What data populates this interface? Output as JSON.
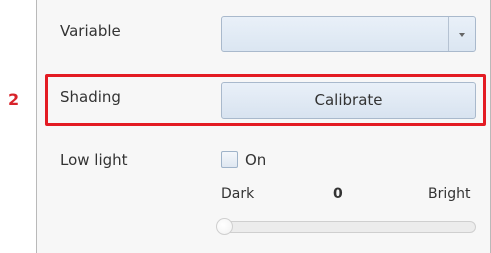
{
  "rows": {
    "variable": {
      "label": "Variable",
      "selected_value": ""
    },
    "shading": {
      "label": "Shading",
      "button_label": "Calibrate"
    },
    "low_light": {
      "label": "Low light",
      "checkbox_label": "On",
      "checked": false,
      "slider": {
        "min_label": "Dark",
        "max_label": "Bright",
        "value_display": "0",
        "value_fraction": 0
      }
    }
  },
  "annotation": {
    "step_number": "2",
    "color": "#e31b23"
  },
  "icons": {
    "dropdown": "chevron-down-icon"
  },
  "colors": {
    "button_face": "#dde7f2",
    "highlight": "#e31b23"
  }
}
